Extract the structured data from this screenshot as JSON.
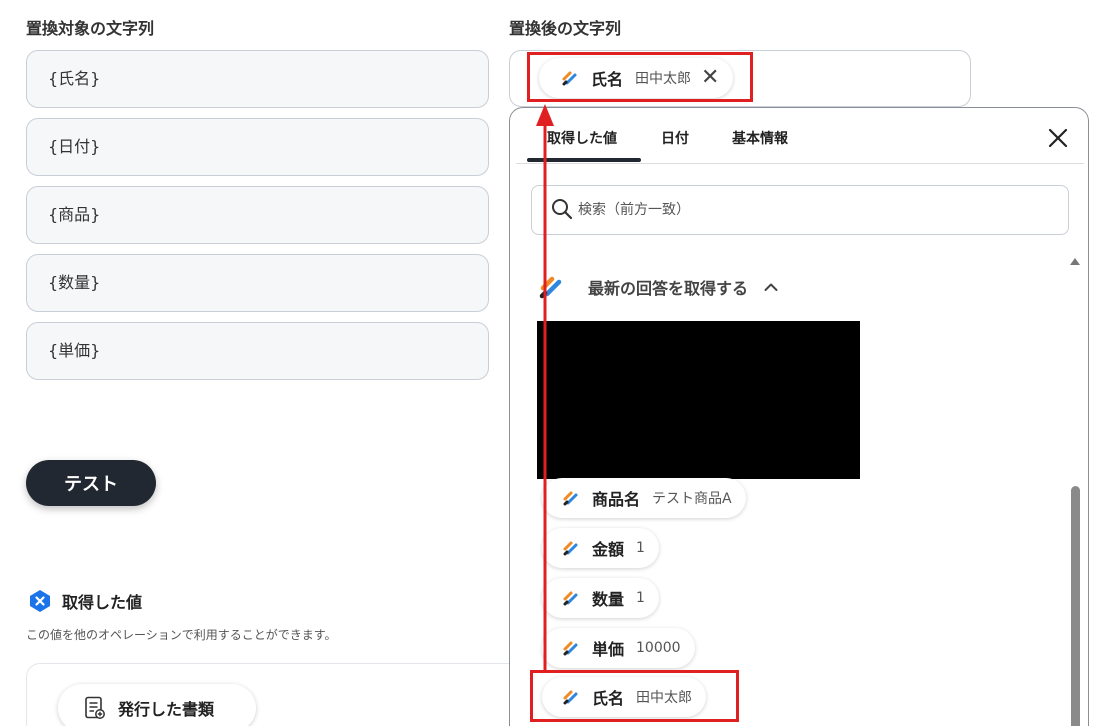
{
  "left": {
    "label": "置換対象の文字列",
    "fields": [
      "{氏名}",
      "{日付}",
      "{商品}",
      "{数量}",
      "{単価}"
    ],
    "test_button": "テスト"
  },
  "right": {
    "label": "置換後の文字列",
    "selected_chip": {
      "name": "氏名",
      "value": "田中太郎",
      "remove": "✕"
    }
  },
  "acquired": {
    "title": "取得した値",
    "description": "この値を他のオペレーションで利用することができます。",
    "doc_button": "発行した書類"
  },
  "dropdown": {
    "tabs": [
      "取得した値",
      "日付",
      "基本情報"
    ],
    "search_placeholder": "検索（前方一致）",
    "section_title": "最新の回答を取得する",
    "items": [
      {
        "name": "商品名",
        "value": "テスト商品A"
      },
      {
        "name": "金額",
        "value": "1"
      },
      {
        "name": "数量",
        "value": "1"
      },
      {
        "name": "単価",
        "value": "10000"
      },
      {
        "name": "氏名",
        "value": "田中太郎"
      }
    ]
  },
  "colors": {
    "highlight": "#e02020",
    "button_dark": "#222831",
    "brand_blue": "#1a73e8"
  }
}
